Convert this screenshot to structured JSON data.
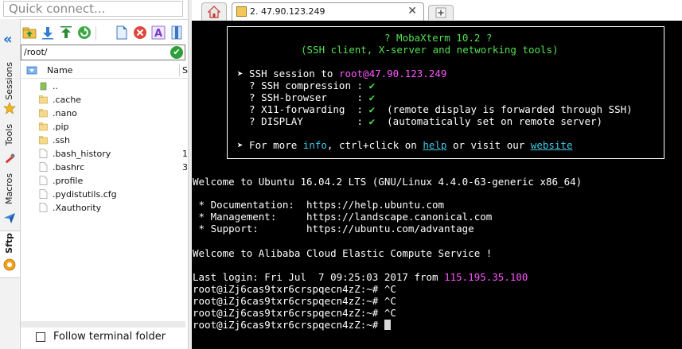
{
  "quick_connect": {
    "placeholder": "Quick connect..."
  },
  "vertical_tabs": [
    "Sessions",
    "Tools",
    "Macros",
    "Sftp"
  ],
  "sftp": {
    "path": "/root/",
    "column_name": "Name",
    "column_size": "S",
    "files": [
      {
        "name": "..",
        "type": "folder-up",
        "size": ""
      },
      {
        "name": ".cache",
        "type": "folder",
        "size": ""
      },
      {
        "name": ".nano",
        "type": "folder",
        "size": ""
      },
      {
        "name": ".pip",
        "type": "folder",
        "size": ""
      },
      {
        "name": ".ssh",
        "type": "folder",
        "size": ""
      },
      {
        "name": ".bash_history",
        "type": "file",
        "size": "1"
      },
      {
        "name": ".bashrc",
        "type": "file",
        "size": "3"
      },
      {
        "name": ".profile",
        "type": "file",
        "size": ""
      },
      {
        "name": ".pydistutils.cfg",
        "type": "file",
        "size": ""
      },
      {
        "name": ".Xauthority",
        "type": "file",
        "size": ""
      }
    ],
    "follow_label": "Follow terminal folder"
  },
  "tabs": {
    "session_title": "2. 47.90.123.249",
    "close_glyph": "✕"
  },
  "terminal": {
    "banner_title": "? MobaXterm 10.2 ?",
    "banner_subtitle": "(SSH client, X-server and networking tools)",
    "ssh_prefix": "➤ SSH session to ",
    "ssh_user": "root",
    "ssh_host": "@47.90.123.249",
    "checks": [
      {
        "label": "  ? SSH compression : ",
        "mark": "✔",
        "note": ""
      },
      {
        "label": "  ? SSH-browser     : ",
        "mark": "✔",
        "note": ""
      },
      {
        "label": "  ? X11-forwarding  : ",
        "mark": "✔",
        "note": "  (remote display is forwarded through SSH)"
      },
      {
        "label": "  ? DISPLAY         : ",
        "mark": "✔",
        "note": "  (automatically set on remote server)"
      }
    ],
    "more_prefix": "➤ For more ",
    "more_info": "info",
    "more_mid": ", ctrl+click on ",
    "more_help": "help",
    "more_mid2": " or visit our ",
    "more_site": "website",
    "welcome": "Welcome to Ubuntu 16.04.2 LTS (GNU/Linux 4.4.0-63-generic x86_64)",
    "doc_line": " * Documentation:  https://help.ubuntu.com",
    "mgmt_line": " * Management:     https://landscape.canonical.com",
    "support_line": " * Support:        https://ubuntu.com/advantage",
    "alibaba": "Welcome to Alibaba Cloud Elastic Compute Service !",
    "last_login_prefix": "Last login: Fri Jul  7 09:25:03 2017 from ",
    "last_login_ip": "115.195.35.100",
    "prompt_lines": [
      "root@iZj6cas9txr6crspqecn4zZ:~# ^C",
      "root@iZj6cas9txr6crspqecn4zZ:~# ^C",
      "root@iZj6cas9txr6crspqecn4zZ:~# ^C"
    ],
    "current_prompt": "root@iZj6cas9txr6crspqecn4zZ:~# "
  }
}
